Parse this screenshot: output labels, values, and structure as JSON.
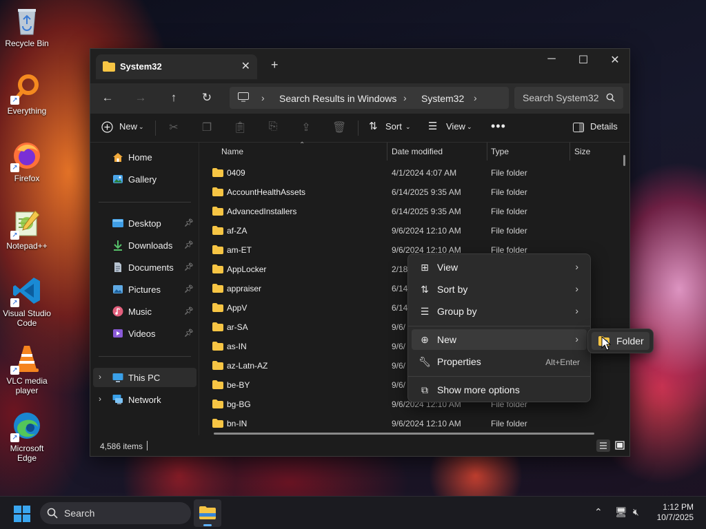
{
  "desktop": {
    "icons": [
      {
        "label": "Recycle Bin",
        "icon": "recycle-bin-icon"
      },
      {
        "label": "Everything",
        "icon": "everything-search-icon"
      },
      {
        "label": "Firefox",
        "icon": "firefox-icon"
      },
      {
        "label": "Notepad++",
        "icon": "notepad-plus-plus-icon"
      },
      {
        "label": "Visual Studio Code",
        "icon": "vscode-icon"
      },
      {
        "label": "VLC media player",
        "icon": "vlc-icon"
      },
      {
        "label": "Microsoft Edge",
        "icon": "edge-icon"
      }
    ]
  },
  "window": {
    "tab_title": "System32",
    "nav": {
      "breadcrumbs": [
        "Search Results in Windows",
        "System32"
      ],
      "search_placeholder": "Search System32"
    },
    "commands": {
      "new_label": "New",
      "sort_label": "Sort",
      "view_label": "View",
      "details_label": "Details"
    },
    "sidebar": {
      "top": [
        {
          "label": "Home",
          "icon": "home-icon"
        },
        {
          "label": "Gallery",
          "icon": "gallery-icon"
        }
      ],
      "quick_access": [
        {
          "label": "Desktop",
          "icon": "desktop-folder-icon"
        },
        {
          "label": "Downloads",
          "icon": "downloads-icon"
        },
        {
          "label": "Documents",
          "icon": "documents-icon"
        },
        {
          "label": "Pictures",
          "icon": "pictures-icon"
        },
        {
          "label": "Music",
          "icon": "music-icon"
        },
        {
          "label": "Videos",
          "icon": "videos-icon"
        }
      ],
      "locations": [
        {
          "label": "This PC",
          "icon": "this-pc-icon",
          "selected": true
        },
        {
          "label": "Network",
          "icon": "network-icon"
        }
      ]
    },
    "columns": [
      "Name",
      "Date modified",
      "Type",
      "Size"
    ],
    "files": [
      {
        "name": "0409",
        "date": "4/1/2024 4:07 AM",
        "type": "File folder"
      },
      {
        "name": "AccountHealthAssets",
        "date": "6/14/2025 9:35 AM",
        "type": "File folder"
      },
      {
        "name": "AdvancedInstallers",
        "date": "6/14/2025 9:35 AM",
        "type": "File folder"
      },
      {
        "name": "af-ZA",
        "date": "9/6/2024 12:10 AM",
        "type": "File folder"
      },
      {
        "name": "am-ET",
        "date": "9/6/2024 12:10 AM",
        "type": "File folder"
      },
      {
        "name": "AppLocker",
        "date": "2/18",
        "type": ""
      },
      {
        "name": "appraiser",
        "date": "6/14",
        "type": ""
      },
      {
        "name": "AppV",
        "date": "6/14",
        "type": ""
      },
      {
        "name": "ar-SA",
        "date": "9/6/",
        "type": ""
      },
      {
        "name": "as-IN",
        "date": "9/6/",
        "type": ""
      },
      {
        "name": "az-Latn-AZ",
        "date": "9/6/",
        "type": ""
      },
      {
        "name": "be-BY",
        "date": "9/6/",
        "type": ""
      },
      {
        "name": "bg-BG",
        "date": "9/6/2024 12:10 AM",
        "type": "File folder"
      },
      {
        "name": "bn-IN",
        "date": "9/6/2024 12:10 AM",
        "type": "File folder"
      }
    ],
    "status": {
      "item_count": "4,586 items"
    }
  },
  "context_menu": {
    "items": [
      {
        "label": "View",
        "icon": "view-grid-icon",
        "submenu": true
      },
      {
        "label": "Sort by",
        "icon": "sort-icon",
        "submenu": true
      },
      {
        "label": "Group by",
        "icon": "group-by-icon",
        "submenu": true
      },
      {
        "label": "New",
        "icon": "new-plus-icon",
        "submenu": true,
        "highlighted": true
      },
      {
        "label": "Properties",
        "icon": "properties-wrench-icon",
        "shortcut": "Alt+Enter"
      },
      {
        "label": "Show more options",
        "icon": "show-more-options-icon"
      }
    ],
    "submenu_new": {
      "label": "Folder",
      "icon": "new-folder-icon"
    }
  },
  "taskbar": {
    "search_label": "Search",
    "time": "1:12 PM",
    "date": "10/7/2025"
  },
  "colors": {
    "folder_yellow": "#f7c544",
    "accent_blue": "#5fb2ff",
    "window_bg": "#1c1c1c"
  }
}
